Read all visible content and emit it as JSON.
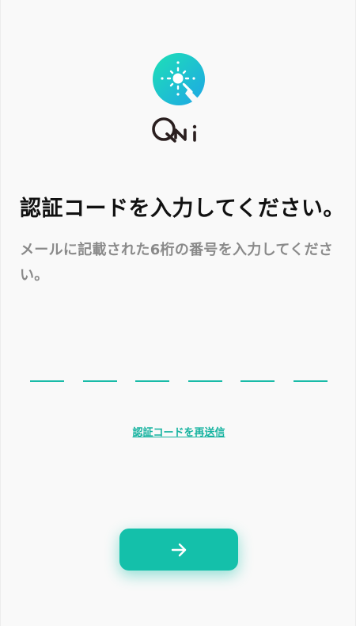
{
  "brand": {
    "icon": "qoo-logo-icon",
    "wordmark_icon": "qni-wordmark-icon",
    "gradient_start": "#1de0b6",
    "gradient_end": "#1fa6e6",
    "wordmark_color": "#2a1f1f"
  },
  "main": {
    "title": "認証コードを入力してください。",
    "subtitle": "メールに記載された6桁の番号を入力してください。",
    "code": {
      "slots": [
        "",
        "",
        "",
        "",
        "",
        ""
      ],
      "underline_color": "#19bba8"
    },
    "resend_label": "認証コードを再送信"
  },
  "actions": {
    "next_icon": "arrow-right-icon",
    "next_color": "#14c0aa"
  }
}
